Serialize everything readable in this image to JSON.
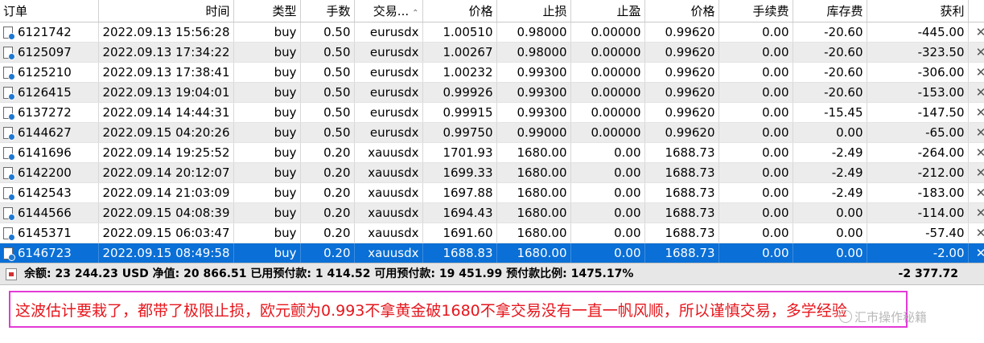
{
  "columns": [
    "订单",
    "时间",
    "类型",
    "手数",
    "交易...",
    "价格",
    "止损",
    "止盈",
    "价格",
    "手续费",
    "库存费",
    "获利"
  ],
  "sort_arrow": "⌃",
  "close_glyph": "✕",
  "rows": [
    [
      "6121742",
      "2022.09.13 15:56:28",
      "buy",
      "0.50",
      "eurusdx",
      "1.00510",
      "0.98000",
      "0.00000",
      "0.99620",
      "0.00",
      "-20.60",
      "-445.00"
    ],
    [
      "6125097",
      "2022.09.13 17:34:22",
      "buy",
      "0.50",
      "eurusdx",
      "1.00267",
      "0.98000",
      "0.00000",
      "0.99620",
      "0.00",
      "-20.60",
      "-323.50"
    ],
    [
      "6125210",
      "2022.09.13 17:38:41",
      "buy",
      "0.50",
      "eurusdx",
      "1.00232",
      "0.99300",
      "0.00000",
      "0.99620",
      "0.00",
      "-20.60",
      "-306.00"
    ],
    [
      "6126415",
      "2022.09.13 19:04:01",
      "buy",
      "0.50",
      "eurusdx",
      "0.99926",
      "0.99300",
      "0.00000",
      "0.99620",
      "0.00",
      "-20.60",
      "-153.00"
    ],
    [
      "6137272",
      "2022.09.14 14:44:31",
      "buy",
      "0.50",
      "eurusdx",
      "0.99915",
      "0.99300",
      "0.00000",
      "0.99620",
      "0.00",
      "-15.45",
      "-147.50"
    ],
    [
      "6144627",
      "2022.09.15 04:20:26",
      "buy",
      "0.50",
      "eurusdx",
      "0.99750",
      "0.99000",
      "0.00000",
      "0.99620",
      "0.00",
      "0.00",
      "-65.00"
    ],
    [
      "6141696",
      "2022.09.14 19:25:52",
      "buy",
      "0.20",
      "xauusdx",
      "1701.93",
      "1680.00",
      "0.00",
      "1688.73",
      "0.00",
      "-2.49",
      "-264.00"
    ],
    [
      "6142200",
      "2022.09.14 20:12:07",
      "buy",
      "0.20",
      "xauusdx",
      "1699.33",
      "1680.00",
      "0.00",
      "1688.73",
      "0.00",
      "-2.49",
      "-212.00"
    ],
    [
      "6142543",
      "2022.09.14 21:03:09",
      "buy",
      "0.20",
      "xauusdx",
      "1697.88",
      "1680.00",
      "0.00",
      "1688.73",
      "0.00",
      "-2.49",
      "-183.00"
    ],
    [
      "6144566",
      "2022.09.15 04:08:39",
      "buy",
      "0.20",
      "xauusdx",
      "1694.43",
      "1680.00",
      "0.00",
      "1688.73",
      "0.00",
      "0.00",
      "-114.00"
    ],
    [
      "6145371",
      "2022.09.15 06:03:47",
      "buy",
      "0.20",
      "xauusdx",
      "1691.60",
      "1680.00",
      "0.00",
      "1688.73",
      "0.00",
      "0.00",
      "-57.40"
    ],
    [
      "6146723",
      "2022.09.15 08:49:58",
      "buy",
      "0.20",
      "xauusdx",
      "1688.83",
      "1680.00",
      "0.00",
      "1688.73",
      "0.00",
      "0.00",
      "-2.00"
    ]
  ],
  "selected_row": 11,
  "summary": {
    "text": "余额: 23 244.23 USD  净值: 20 866.51  已用预付款: 1 414.52  可用预付款: 19 451.99  预付款比例: 1475.17%",
    "total": "-2 377.72"
  },
  "note": "这波估计要栽了，都带了极限止损，欧元颤为0.993不拿黄金破1680不拿交易没有一直一帆风顺，所以谨慎交易，多学经验",
  "watermark": "汇市操作秘籍",
  "colors": {
    "selected_row": "#0a6fd6",
    "note_text": "#e6161c",
    "note_border": "#e23ad6"
  }
}
